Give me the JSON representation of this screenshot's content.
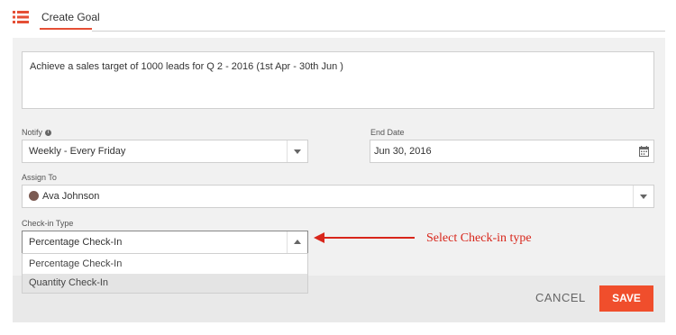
{
  "header": {
    "tab_label": "Create Goal"
  },
  "goal": {
    "description": "Achieve a sales target of 1000 leads for Q 2 - 2016 (1st Apr - 30th Jun )"
  },
  "notify": {
    "label": "Notify",
    "value": "Weekly - Every Friday"
  },
  "end_date": {
    "label": "End Date",
    "value": "Jun 30, 2016"
  },
  "assign_to": {
    "label": "Assign To",
    "value": "Ava Johnson"
  },
  "checkin": {
    "label": "Check-in Type",
    "value": "Percentage Check-In",
    "options": [
      "Percentage Check-In",
      "Quantity Check-In"
    ]
  },
  "annotation": {
    "text": "Select Check-in type"
  },
  "footer": {
    "cancel_label": "CANCEL",
    "save_label": "SAVE"
  },
  "colors": {
    "accent": "#f04e2c",
    "annotation": "#d8261b"
  }
}
